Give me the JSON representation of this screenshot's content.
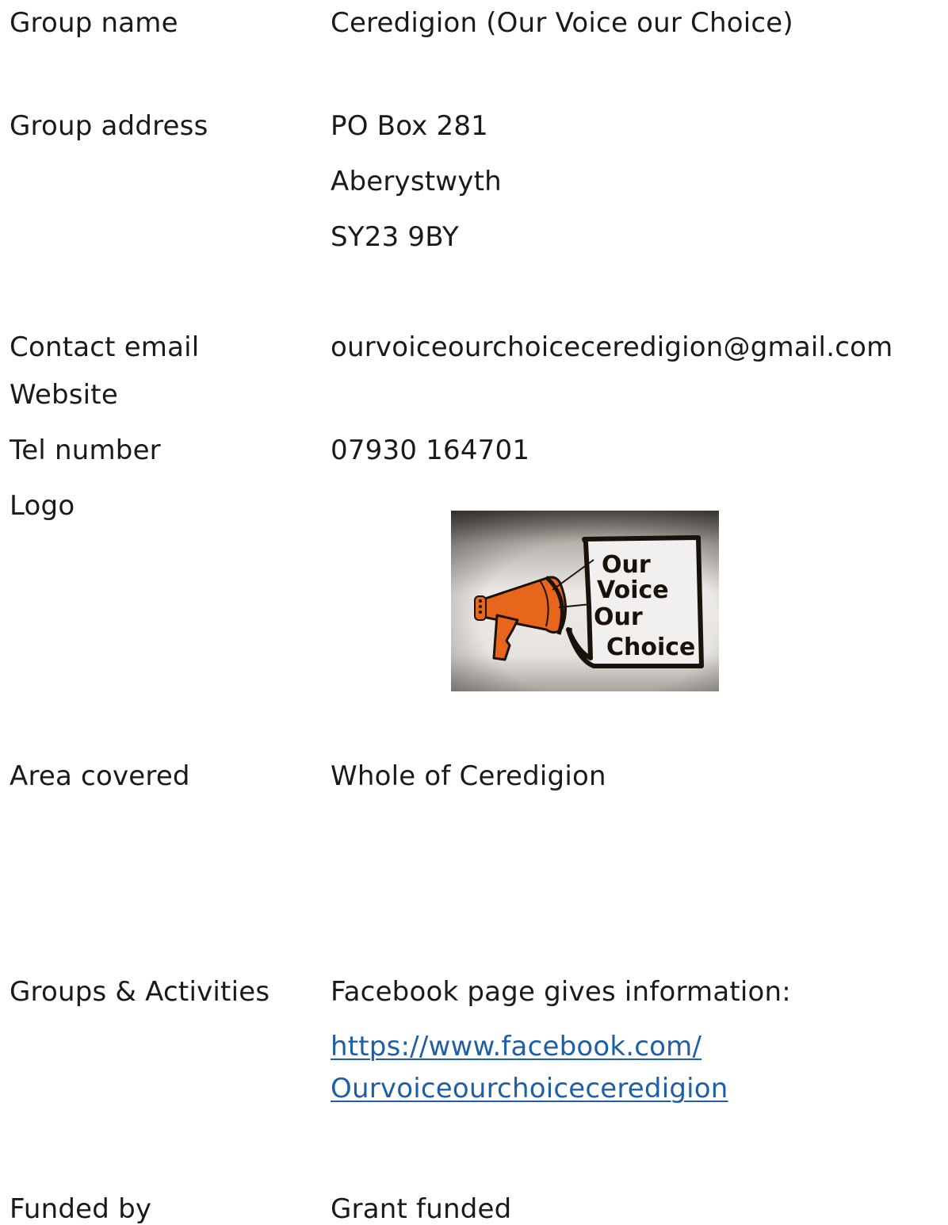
{
  "group_name": {
    "label": "Group name",
    "value": "Ceredigion (Our Voice our Choice)"
  },
  "group_address": {
    "label": "Group address",
    "lines": [
      "PO Box 281",
      "Aberystwyth",
      "SY23 9BY"
    ]
  },
  "contact_email": {
    "label": "Contact email",
    "value": "ourvoiceourchoiceceredigion@gmail.com"
  },
  "website": {
    "label": "Website"
  },
  "tel_number": {
    "label": "Tel number",
    "value": "07930 164701"
  },
  "logo": {
    "label": "Logo",
    "image_text": [
      "Our",
      "Voice",
      "Our",
      "Choice"
    ],
    "colors": {
      "megaphone": "#e8661c",
      "outline": "#1a1208",
      "background": "#ece9e6"
    }
  },
  "area_covered": {
    "label": "Area covered",
    "value": "Whole of Ceredigion"
  },
  "groups_activities": {
    "label": "Groups & Activities",
    "intro": "Facebook page gives information:",
    "link_line1": "https://www.facebook.com/",
    "link_line2": "Ourvoiceourchoiceceredigion"
  },
  "funded_by": {
    "label": "Funded by",
    "value": "Grant funded"
  },
  "colors": {
    "text": "#1a1a1a",
    "link": "#1f5fa8"
  }
}
